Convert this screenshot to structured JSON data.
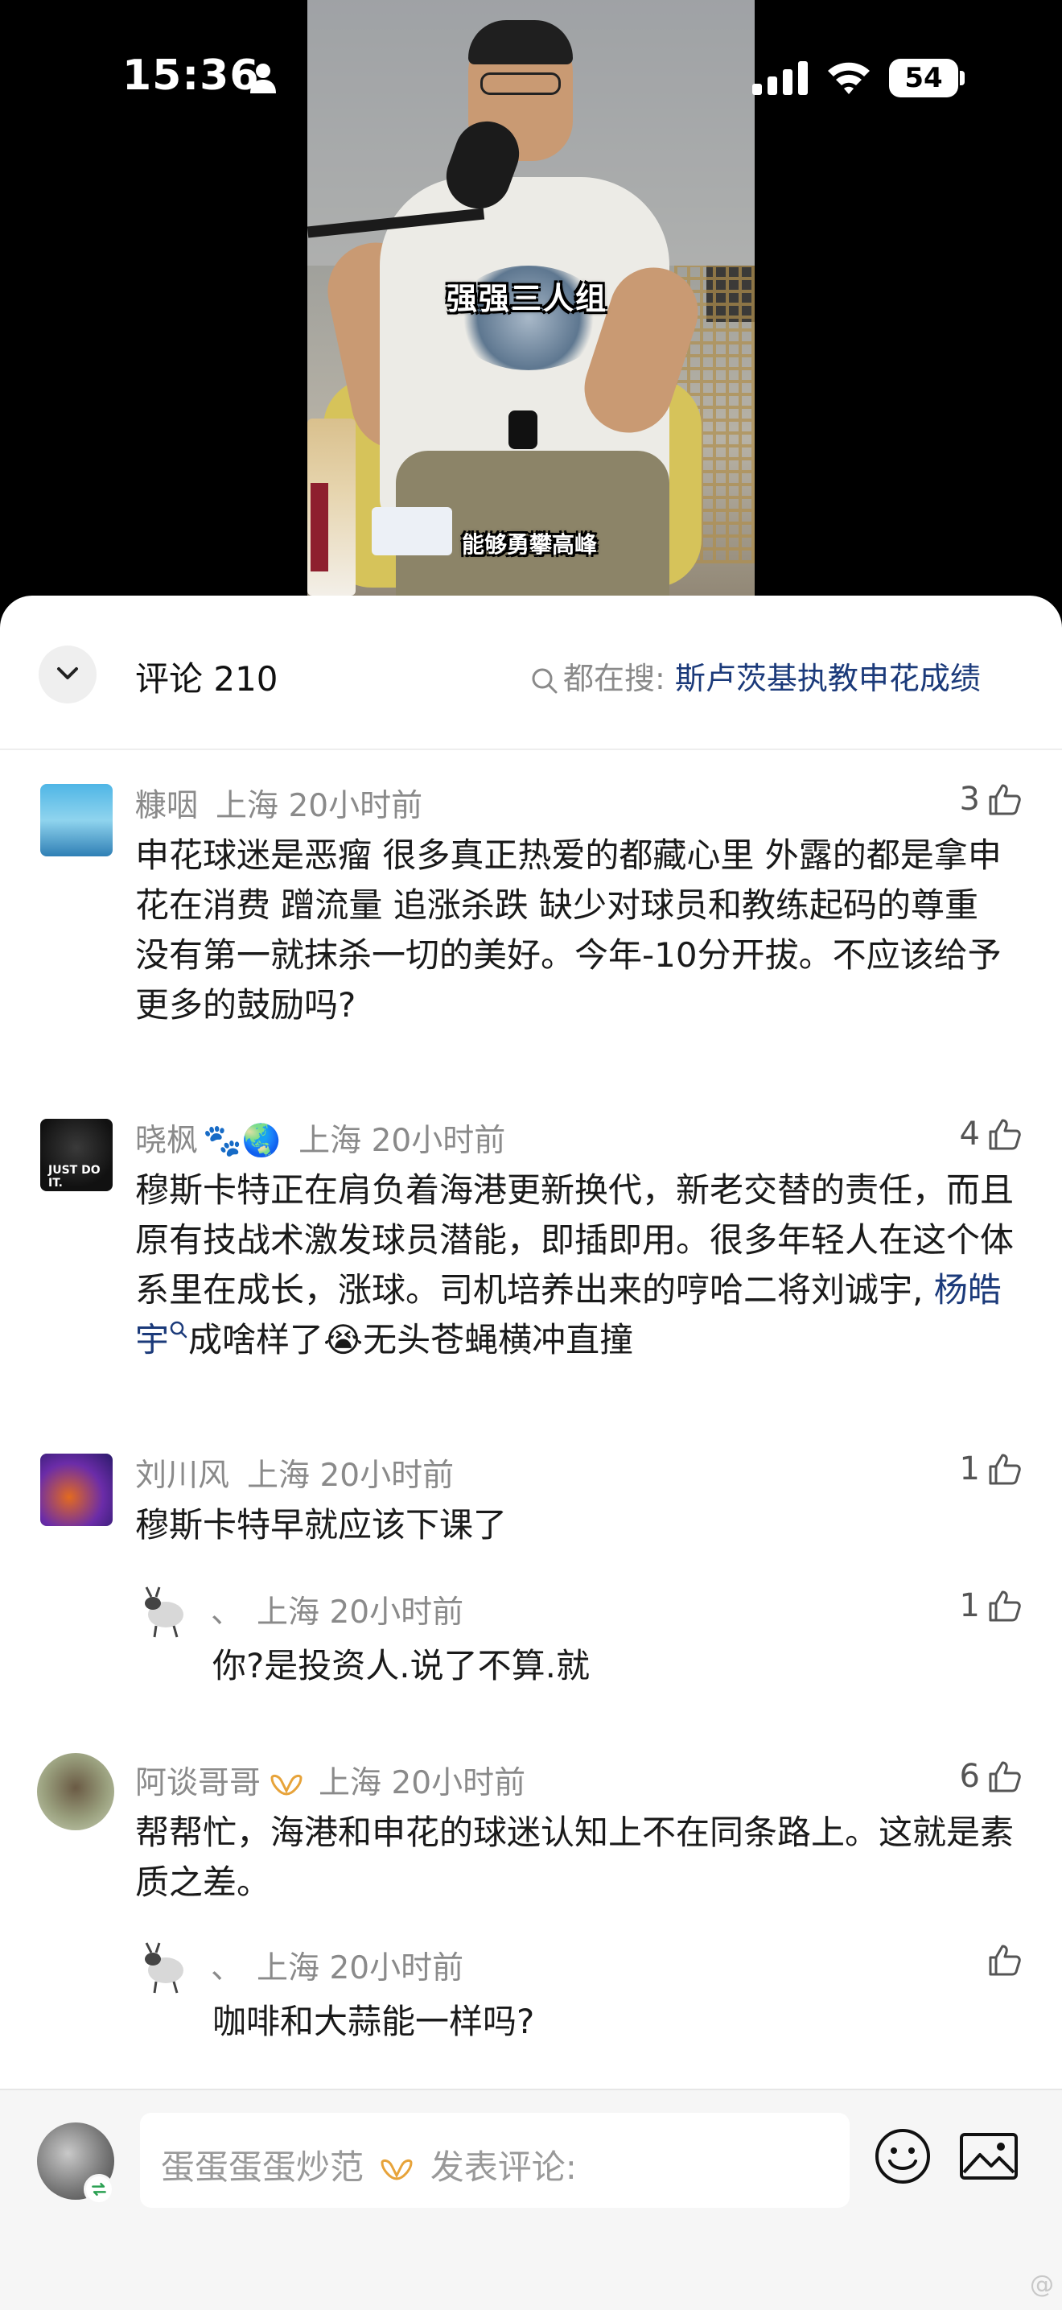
{
  "status_bar": {
    "time": "15:36",
    "battery": "54",
    "icons": [
      "person-icon",
      "signal-icon",
      "wifi-icon",
      "battery-icon"
    ]
  },
  "video": {
    "caption_top": "强强三人组",
    "caption_bottom": "能够勇攀高峰"
  },
  "header": {
    "title": "评论 210",
    "search_prefix": "都在搜:",
    "search_term": "斯卢茨基执教申花成绩"
  },
  "comments": [
    {
      "user": "糠咽",
      "location": "上海",
      "time": "20小时前",
      "likes": "3",
      "text": "申花球迷是恶瘤 很多真正热爱的都藏心里 外露的都是拿申花在消费 蹭流量 追涨杀跌 缺少对球员和教练起码的尊重 没有第一就抹杀一切的美好。今年-10分开拔。不应该给予更多的鼓励吗?"
    },
    {
      "user": "晓枫",
      "badges": "🐾🌏",
      "location": "上海",
      "time": "20小时前",
      "likes": "4",
      "text_before": "穆斯卡特正在肩负着海港更新换代，新老交替的责任，而且原有技战术激发球员潜能，即插即用。很多年轻人在这个体系里在成长，涨球。司机培养出来的哼哈二将刘诚宇, ",
      "link": "杨皓宇",
      "text_after": "成啥样了😭无头苍蝇横冲直撞"
    },
    {
      "user": "刘川风",
      "location": "上海",
      "time": "20小时前",
      "likes": "1",
      "text": "穆斯卡特早就应该下课了",
      "reply": {
        "user": "、",
        "location": "上海",
        "time": "20小时前",
        "likes": "1",
        "text": "你?是投资人.说了不算.就"
      }
    },
    {
      "user": "阿谈哥哥",
      "location": "上海",
      "time": "20小时前",
      "likes": "6",
      "text": "帮帮忙，海港和申花的球迷认知上不在同条路上。这就是素质之差。",
      "reply": {
        "user": "、",
        "location": "上海",
        "time": "20小时前",
        "likes": "",
        "text": "咖啡和大蒜能一样吗?"
      }
    }
  ],
  "input": {
    "user": "蛋蛋蛋蛋炒范",
    "placeholder": "发表评论:"
  },
  "watermark": "@"
}
